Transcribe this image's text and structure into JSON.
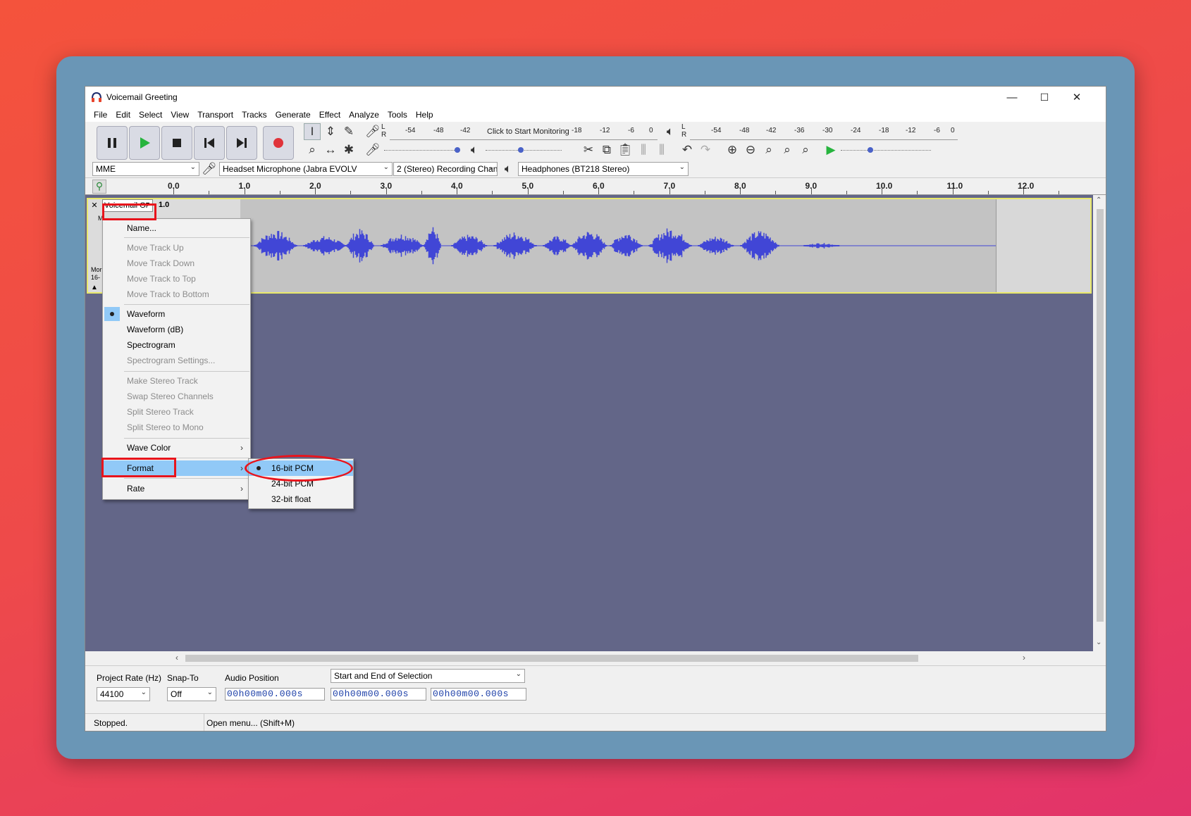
{
  "window": {
    "title": "Voicemail Greeting",
    "controls": {
      "minimize": "—",
      "maximize": "☐",
      "close": "✕"
    }
  },
  "menubar": [
    "File",
    "Edit",
    "Select",
    "View",
    "Transport",
    "Tracks",
    "Generate",
    "Effect",
    "Analyze",
    "Tools",
    "Help"
  ],
  "transport": {
    "pause_icon": "pause-icon",
    "play_icon": "play-icon",
    "stop_icon": "stop-icon",
    "skip_start_icon": "skip-to-start-icon",
    "skip_end_icon": "skip-to-end-icon",
    "record_icon": "record-icon"
  },
  "meters": {
    "record_ticks": [
      "-54",
      "-48",
      "-42",
      "Click to Start Monitoring",
      "-18",
      "-12",
      "-6",
      "0"
    ],
    "playback_ticks": [
      "-54",
      "-48",
      "-42",
      "-36",
      "-30",
      "-24",
      "-18",
      "-12",
      "-6",
      "0"
    ],
    "lr": [
      "L",
      "R"
    ]
  },
  "devices": {
    "host": "MME",
    "recording_device": "Headset Microphone (Jabra EVOLV",
    "channels": "2 (Stereo) Recording Chan",
    "playback_device": "Headphones (BT218 Stereo)"
  },
  "ruler": {
    "labels": [
      "0.0",
      "1.0",
      "2.0",
      "3.0",
      "4.0",
      "5.0",
      "6.0",
      "7.0",
      "8.0",
      "9.0",
      "10.0",
      "11.0",
      "12.0"
    ]
  },
  "track": {
    "name": "Voicemail Gr",
    "gain_label": "1.0",
    "info_lines": [
      "Mor",
      "16-"
    ],
    "mute_short": "M"
  },
  "context_menu": {
    "items": [
      {
        "label": "Name...",
        "disabled": false
      },
      {
        "label": "Move Track Up",
        "disabled": true
      },
      {
        "label": "Move Track Down",
        "disabled": true
      },
      {
        "label": "Move Track to Top",
        "disabled": true
      },
      {
        "label": "Move Track to Bottom",
        "disabled": true
      },
      {
        "label": "Waveform",
        "disabled": false,
        "checked": true
      },
      {
        "label": "Waveform (dB)",
        "disabled": false
      },
      {
        "label": "Spectrogram",
        "disabled": false
      },
      {
        "label": "Spectrogram Settings...",
        "disabled": true
      },
      {
        "label": "Make Stereo Track",
        "disabled": true
      },
      {
        "label": "Swap Stereo Channels",
        "disabled": true
      },
      {
        "label": "Split Stereo Track",
        "disabled": true
      },
      {
        "label": "Split Stereo to Mono",
        "disabled": true
      },
      {
        "label": "Wave Color",
        "disabled": false,
        "submenu": true
      },
      {
        "label": "Format",
        "disabled": false,
        "submenu": true,
        "highlighted": true
      },
      {
        "label": "Rate",
        "disabled": false,
        "submenu": true
      }
    ],
    "submenu_arrow": "›"
  },
  "format_submenu": {
    "items": [
      {
        "label": "16-bit PCM",
        "checked": true,
        "highlighted": true
      },
      {
        "label": "24-bit PCM",
        "checked": false
      },
      {
        "label": "32-bit float",
        "checked": false
      }
    ]
  },
  "selection_toolbar": {
    "project_rate_label": "Project Rate (Hz)",
    "project_rate_value": "44100",
    "snap_to_label": "Snap-To",
    "snap_to_value": "Off",
    "audio_position_label": "Audio Position",
    "audio_position_value": "00h00m00.000s",
    "selection_mode": "Start and End of Selection",
    "selection_start": "00h00m00.000s",
    "selection_end": "00h00m00.000s"
  },
  "status": {
    "state": "Stopped.",
    "hint": "Open menu... (Shift+M)"
  },
  "colors": {
    "waveform": "#4146d6",
    "track_background": "#636688",
    "menu_highlight": "#91c9f7",
    "annotation_red": "#e8141c",
    "play_green": "#27b43e",
    "record_red": "#e0333a"
  }
}
